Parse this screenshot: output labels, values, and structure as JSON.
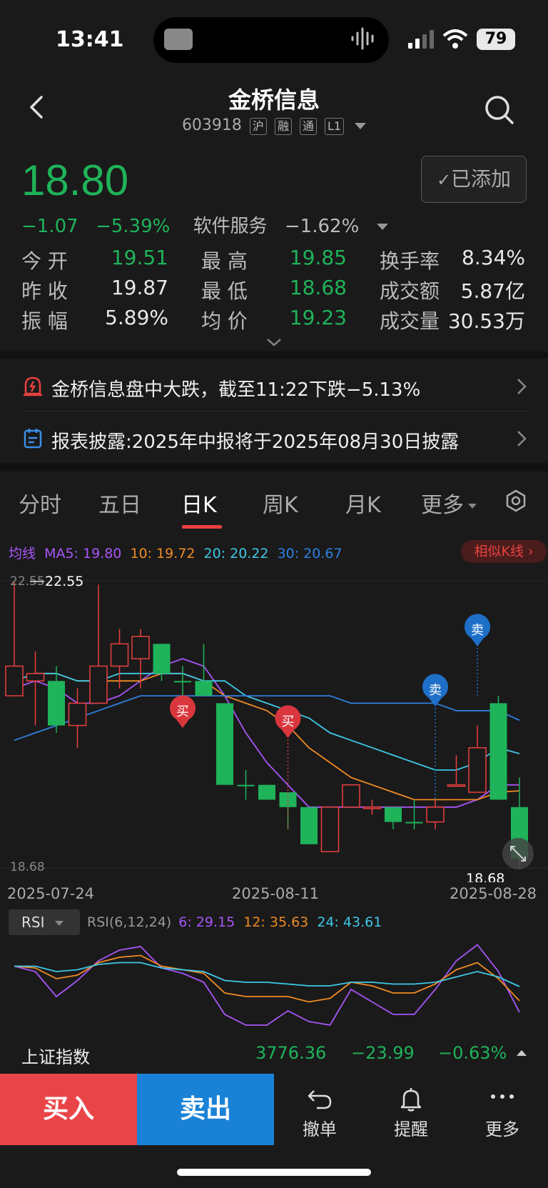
{
  "status_bar": {
    "time": "13:41",
    "battery": "79"
  },
  "header": {
    "title": "金桥信息",
    "code": "603918",
    "tags": [
      "沪",
      "融",
      "通",
      "L1"
    ]
  },
  "quote": {
    "price": "18.80",
    "change": "−1.07",
    "change_pct": "−5.39%",
    "sector": "软件服务",
    "sector_change": "−1.62%",
    "added_label": "已添加",
    "stats": [
      {
        "label": "今 开",
        "value": "19.51",
        "color": "#1fb35a"
      },
      {
        "label": "最 高",
        "value": "19.85",
        "color": "#1fb35a"
      },
      {
        "label": "换手率",
        "value": "8.34%",
        "color": "#e8e8e8"
      },
      {
        "label": "昨 收",
        "value": "19.87",
        "color": "#e8e8e8"
      },
      {
        "label": "最 低",
        "value": "18.68",
        "color": "#1fb35a"
      },
      {
        "label": "成交额",
        "value": "5.87亿",
        "color": "#e8e8e8"
      },
      {
        "label": "振 幅",
        "value": "5.89%",
        "color": "#e8e8e8"
      },
      {
        "label": "均 价",
        "value": "19.23",
        "color": "#1fb35a"
      },
      {
        "label": "成交量",
        "value": "30.53万",
        "color": "#e8e8e8"
      }
    ]
  },
  "news": [
    {
      "text": "金桥信息盘中大跌，截至11:22下跌−5.13%",
      "icon": "alarm-icon"
    },
    {
      "text": "报表披露:2025年中报将于2025年08月30日披露",
      "icon": "calendar-icon"
    }
  ],
  "tabs": [
    "分时",
    "五日",
    "日K",
    "周K",
    "月K",
    "更多"
  ],
  "active_tab": "日K",
  "ma": {
    "label": "均线",
    "items": [
      {
        "text": "MA5: 19.80",
        "color": "#a855f7"
      },
      {
        "text": "10: 19.72",
        "color": "#f08a24"
      },
      {
        "text": "20: 20.22",
        "color": "#3ec8e8"
      },
      {
        "text": "30: 20.67",
        "color": "#2f7fe0"
      }
    ]
  },
  "similar_k": "相似K线",
  "chart_labels": {
    "high_left": "22.55",
    "high_marker": "22.55",
    "low_left": "18.68",
    "low_marker": "18.68",
    "date_start": "2025-07-24",
    "date_mid": "2025-08-11",
    "date_end": "2025-08-28",
    "buy_mark": "买",
    "sell_mark": "卖"
  },
  "chart_data": {
    "type": "candlestick",
    "ylim": [
      18.68,
      22.55
    ],
    "x": [
      "2025-07-24",
      "2025-08-11",
      "2025-08-28"
    ],
    "candles": [
      {
        "o": 21.0,
        "c": 21.4,
        "h": 22.55,
        "l": 21.0,
        "dir": "up"
      },
      {
        "o": 21.2,
        "c": 21.3,
        "h": 21.6,
        "l": 20.6,
        "dir": "up"
      },
      {
        "o": 21.2,
        "c": 20.6,
        "h": 21.4,
        "l": 20.5,
        "dir": "down"
      },
      {
        "o": 20.6,
        "c": 20.9,
        "h": 21.1,
        "l": 20.3,
        "dir": "up"
      },
      {
        "o": 20.9,
        "c": 21.4,
        "h": 22.5,
        "l": 20.9,
        "dir": "up"
      },
      {
        "o": 21.4,
        "c": 21.7,
        "h": 21.9,
        "l": 21.1,
        "dir": "up"
      },
      {
        "o": 21.5,
        "c": 21.8,
        "h": 21.9,
        "l": 21.1,
        "dir": "up"
      },
      {
        "o": 21.7,
        "c": 21.3,
        "h": 21.7,
        "l": 21.2,
        "dir": "down"
      },
      {
        "o": 21.2,
        "c": 21.2,
        "h": 21.4,
        "l": 20.8,
        "dir": "down"
      },
      {
        "o": 21.2,
        "c": 21.0,
        "h": 21.7,
        "l": 21.0,
        "dir": "down"
      },
      {
        "o": 20.9,
        "c": 19.8,
        "h": 20.9,
        "l": 19.8,
        "dir": "down"
      },
      {
        "o": 19.8,
        "c": 19.8,
        "h": 20.0,
        "l": 19.6,
        "dir": "down"
      },
      {
        "o": 19.8,
        "c": 19.6,
        "h": 19.8,
        "l": 19.6,
        "dir": "down"
      },
      {
        "o": 19.7,
        "c": 19.5,
        "h": 19.7,
        "l": 19.2,
        "dir": "down"
      },
      {
        "o": 19.5,
        "c": 19.0,
        "h": 19.5,
        "l": 19.0,
        "dir": "down"
      },
      {
        "o": 18.9,
        "c": 19.5,
        "h": 19.5,
        "l": 18.9,
        "dir": "up"
      },
      {
        "o": 19.5,
        "c": 19.8,
        "h": 19.8,
        "l": 19.5,
        "dir": "up"
      },
      {
        "o": 19.5,
        "c": 19.5,
        "h": 19.6,
        "l": 19.4,
        "dir": "up"
      },
      {
        "o": 19.5,
        "c": 19.3,
        "h": 19.5,
        "l": 19.2,
        "dir": "down"
      },
      {
        "o": 19.3,
        "c": 19.3,
        "h": 19.6,
        "l": 19.2,
        "dir": "down"
      },
      {
        "o": 19.3,
        "c": 19.5,
        "h": 19.6,
        "l": 19.2,
        "dir": "up"
      },
      {
        "o": 19.8,
        "c": 19.8,
        "h": 20.2,
        "l": 19.8,
        "dir": "up"
      },
      {
        "o": 19.7,
        "c": 20.3,
        "h": 20.6,
        "l": 19.7,
        "dir": "up"
      },
      {
        "o": 19.6,
        "c": 20.9,
        "h": 21.0,
        "l": 19.6,
        "dir": "down"
      },
      {
        "o": 19.5,
        "c": 18.8,
        "h": 19.9,
        "l": 18.68,
        "dir": "down"
      }
    ],
    "series": [
      {
        "name": "MA5",
        "values": [
          21.1,
          21.2,
          21.1,
          20.9,
          20.9,
          21.0,
          21.2,
          21.4,
          21.5,
          21.4,
          21.0,
          20.5,
          20.1,
          19.8,
          19.5,
          19.5,
          19.5,
          19.5,
          19.5,
          19.5,
          19.5,
          19.5,
          19.6,
          19.8,
          19.8
        ]
      },
      {
        "name": "10",
        "values": [
          21.2,
          21.3,
          21.3,
          21.2,
          21.2,
          21.2,
          21.2,
          21.3,
          21.3,
          21.2,
          21.0,
          20.9,
          20.8,
          20.6,
          20.3,
          20.1,
          19.9,
          19.8,
          19.7,
          19.6,
          19.6,
          19.6,
          19.6,
          19.7,
          19.72
        ]
      },
      {
        "name": "20",
        "values": [
          21.2,
          21.3,
          21.3,
          21.2,
          21.2,
          21.3,
          21.3,
          21.3,
          21.3,
          21.2,
          21.2,
          21.0,
          20.9,
          20.8,
          20.7,
          20.5,
          20.4,
          20.3,
          20.2,
          20.1,
          20.0,
          20.0,
          20.1,
          20.3,
          20.22
        ]
      },
      {
        "name": "30",
        "values": [
          20.4,
          20.5,
          20.6,
          20.7,
          20.8,
          20.9,
          21.0,
          21.0,
          21.0,
          21.0,
          21.0,
          21.0,
          21.0,
          21.0,
          21.0,
          21.0,
          20.9,
          20.9,
          20.9,
          20.9,
          20.9,
          20.8,
          20.8,
          20.8,
          20.67
        ]
      }
    ],
    "rsi": {
      "selector": "RSI",
      "params": "RSI(6,12,24)",
      "items": [
        {
          "text": "6: 29.15",
          "color": "#a855f7"
        },
        {
          "text": "12: 35.63",
          "color": "#f08a24"
        },
        {
          "text": "24: 43.61",
          "color": "#3ec8e8"
        }
      ],
      "series": [
        {
          "name": "6",
          "values": [
            55,
            52,
            38,
            47,
            58,
            64,
            66,
            54,
            51,
            46,
            28,
            22,
            22,
            30,
            24,
            22,
            42,
            35,
            28,
            28,
            42,
            58,
            67,
            52,
            29.15
          ]
        },
        {
          "name": "12",
          "values": [
            55,
            54,
            48,
            50,
            57,
            60,
            61,
            55,
            53,
            51,
            40,
            38,
            38,
            38,
            35,
            37,
            46,
            44,
            40,
            40,
            45,
            53,
            57,
            48,
            35.63
          ]
        },
        {
          "name": "24",
          "values": [
            55,
            55,
            52,
            53,
            56,
            57,
            57,
            54,
            53,
            52,
            47,
            46,
            46,
            45,
            44,
            44,
            46,
            46,
            45,
            45,
            46,
            49,
            52,
            49,
            43.61
          ]
        }
      ]
    }
  },
  "index": {
    "name": "上证指数",
    "value": "3776.36",
    "change": "−23.99",
    "pct": "−0.63%"
  },
  "bottom": {
    "buy": "买入",
    "sell": "卖出",
    "cancel": "撤单",
    "alert": "提醒",
    "more": "更多"
  }
}
